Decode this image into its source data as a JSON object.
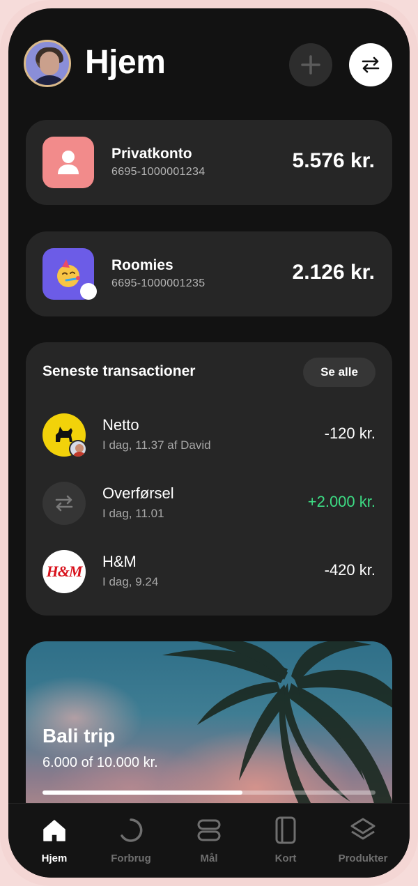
{
  "header": {
    "title": "Hjem",
    "add_icon": "plus-icon",
    "transfer_icon": "transfer-arrows-icon"
  },
  "accounts": [
    {
      "name": "Privatkonto",
      "number": "6695-1000001234",
      "balance": "5.576 kr.",
      "icon": "person-icon",
      "color": "#f28b8b"
    },
    {
      "name": "Roomies",
      "number": "6695-1000001235",
      "balance": "2.126 kr.",
      "icon": "party-face-emoji",
      "color": "#6c5ce7"
    }
  ],
  "transactions": {
    "title": "Seneste transactioner",
    "see_all": "Se alle",
    "items": [
      {
        "name": "Netto",
        "meta": "I dag, 11.37 af David",
        "amount": "-120 kr.",
        "icon": "netto-logo"
      },
      {
        "name": "Overførsel",
        "meta": "I dag, 11.01",
        "amount": "+2.000 kr.",
        "icon": "transfer-arrows-icon"
      },
      {
        "name": "H&M",
        "meta": "I dag, 9.24",
        "amount": "-420 kr.",
        "icon": "hm-logo",
        "logo_text": "H&M"
      }
    ]
  },
  "goal": {
    "title": "Bali trip",
    "progress_text": "6.000 of 10.000 kr.",
    "progress": 0.6
  },
  "tabs": [
    {
      "label": "Hjem",
      "icon": "home-icon",
      "active": true
    },
    {
      "label": "Forbrug",
      "icon": "spending-ring-icon",
      "active": false
    },
    {
      "label": "Mål",
      "icon": "goals-icon",
      "active": false
    },
    {
      "label": "Kort",
      "icon": "card-icon",
      "active": false
    },
    {
      "label": "Produkter",
      "icon": "layers-icon",
      "active": false
    }
  ],
  "colors": {
    "background": "#121212",
    "card": "#262626",
    "positive": "#3ddc84",
    "frame": "#f4d6d4"
  }
}
